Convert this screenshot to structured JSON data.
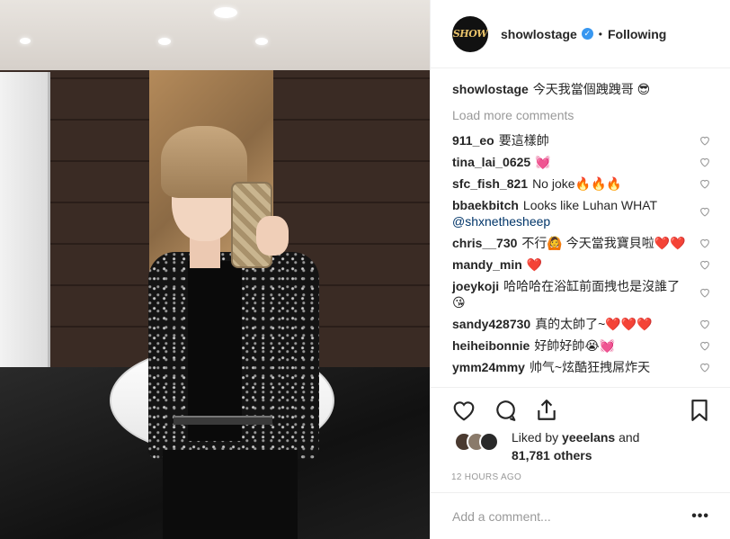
{
  "post": {
    "header": {
      "avatar_text": "SHOW",
      "username": "showlostage",
      "verified_icon": "verified-badge-icon",
      "separator": "•",
      "follow_status": "Following"
    },
    "caption": {
      "username": "showlostage",
      "text": "今天我當個跩跩哥 😎"
    },
    "load_more": "Load more comments",
    "comments": [
      {
        "user": "911_eo",
        "text": "要這樣帥"
      },
      {
        "user": "tina_lai_0625",
        "text": "💓"
      },
      {
        "user": "sfc_fish_821",
        "text": "No joke🔥🔥🔥"
      },
      {
        "user": "bbaekbitch",
        "text": "Looks like Luhan WHAT",
        "mention": "@shxnethesheep"
      },
      {
        "user": "chris__730",
        "text": "不行🙆 今天當我寶貝啦❤️❤️"
      },
      {
        "user": "mandy_min",
        "text": "❤️"
      },
      {
        "user": "joeykoji",
        "text": "哈哈哈在浴缸前面拽也是沒誰了😘"
      },
      {
        "user": "sandy428730",
        "text": "真的太帥了~❤️❤️❤️"
      },
      {
        "user": "heiheibonnie",
        "text": "好帥好帥😭💓"
      },
      {
        "user": "ymm24mmy",
        "text": "帅气~炫酷狂拽屌炸天"
      }
    ],
    "likes": {
      "prefix": "Liked by",
      "user": "yeeelans",
      "and": "and",
      "count": "81,781 others"
    },
    "timestamp": "12 HOURS AGO",
    "add_comment_placeholder": "Add a comment...",
    "more_label": "•••"
  },
  "colors": {
    "accent_blue": "#3897f0",
    "mention": "#003569",
    "muted": "#999999",
    "text": "#262626"
  }
}
